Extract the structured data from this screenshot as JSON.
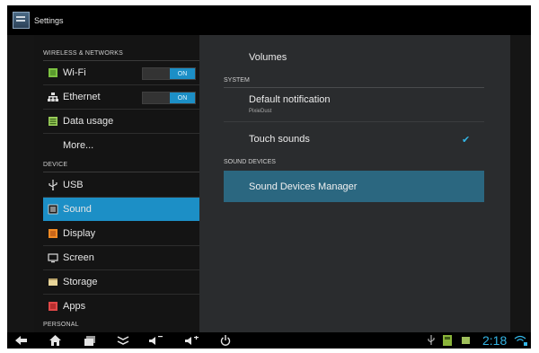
{
  "titlebar": {
    "title": "Settings"
  },
  "left": {
    "section_wireless": "WIRELESS & NETWORKS",
    "wifi": {
      "label": "Wi-Fi",
      "toggle": "ON"
    },
    "ethernet": {
      "label": "Ethernet",
      "toggle": "ON"
    },
    "data_usage": "Data usage",
    "more": "More...",
    "section_device": "DEVICE",
    "usb": "USB",
    "sound": "Sound",
    "display": "Display",
    "screen": "Screen",
    "storage": "Storage",
    "apps": "Apps",
    "section_personal": "PERSONAL"
  },
  "right": {
    "volumes": "Volumes",
    "section_system": "SYSTEM",
    "default_notification": "Default notification",
    "default_notification_value": "PixieDust",
    "touch_sounds": "Touch sounds",
    "touch_sounds_checked": "✔",
    "section_sound_devices": "SOUND DEVICES",
    "sound_devices_manager": "Sound Devices Manager"
  },
  "statusbar": {
    "time": "2:18"
  },
  "icons": {
    "back": "back-icon",
    "home": "home-icon",
    "recents": "recent-apps-icon",
    "menu": "menu-collapse-icon",
    "vol_down": "volume-down-icon",
    "vol_up": "volume-up-icon",
    "power": "power-icon",
    "usb": "usb-icon",
    "sdcard": "sd-card-icon",
    "battery": "battery-icon",
    "wifi": "wifi-signal-icon"
  },
  "colors": {
    "accent": "#1c8fc6",
    "selected_right": "#2b6780",
    "background": "#141414"
  }
}
